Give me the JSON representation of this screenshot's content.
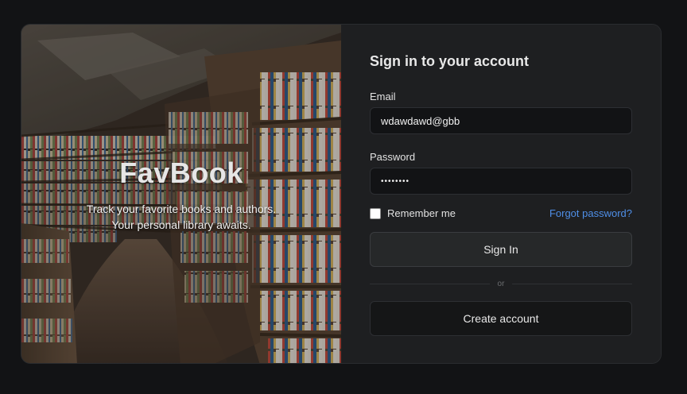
{
  "hero": {
    "brand": "FavBook",
    "tagline": "Track your favorite books and authors. Your personal library awaits."
  },
  "form": {
    "title": "Sign in to your account",
    "email_label": "Email",
    "email_value": "wdawdawd@gbb",
    "password_label": "Password",
    "password_value": "••••••••",
    "remember_label": "Remember me",
    "remember_checked": false,
    "forgot_link": "Forgot password?",
    "sign_in_button": "Sign In",
    "divider_text": "or",
    "create_account_button": "Create account"
  },
  "colors": {
    "background": "#121315",
    "panel": "#1e1f21",
    "link": "#4f8fe8"
  }
}
